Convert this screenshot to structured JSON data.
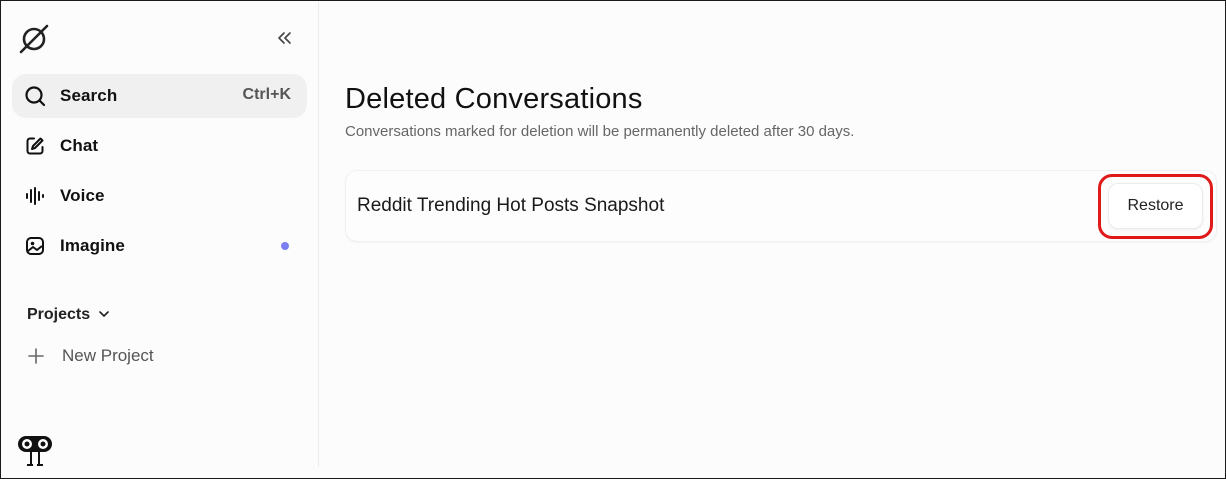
{
  "sidebar": {
    "logo_icon": "grok-logo-icon",
    "collapse_icon": "double-chevron-left-icon",
    "items": [
      {
        "label": "Search",
        "icon": "search-icon",
        "shortcut": "Ctrl+K",
        "active": true
      },
      {
        "label": "Chat",
        "icon": "edit-icon"
      },
      {
        "label": "Voice",
        "icon": "waveform-icon"
      },
      {
        "label": "Imagine",
        "icon": "image-icon",
        "badge_color": "#7b7ff0"
      }
    ],
    "projects": {
      "label": "Projects",
      "icon": "chevron-down-icon"
    },
    "new_project": {
      "label": "New Project",
      "icon": "plus-icon"
    },
    "avatar_icon": "avatar-icon"
  },
  "main": {
    "title": "Deleted Conversations",
    "subtitle": "Conversations marked for deletion will be permanently deleted after 30 days.",
    "conversations": [
      {
        "title": "Reddit Trending Hot Posts Snapshot",
        "action_label": "Restore"
      }
    ],
    "highlight_color": "#e01919"
  }
}
